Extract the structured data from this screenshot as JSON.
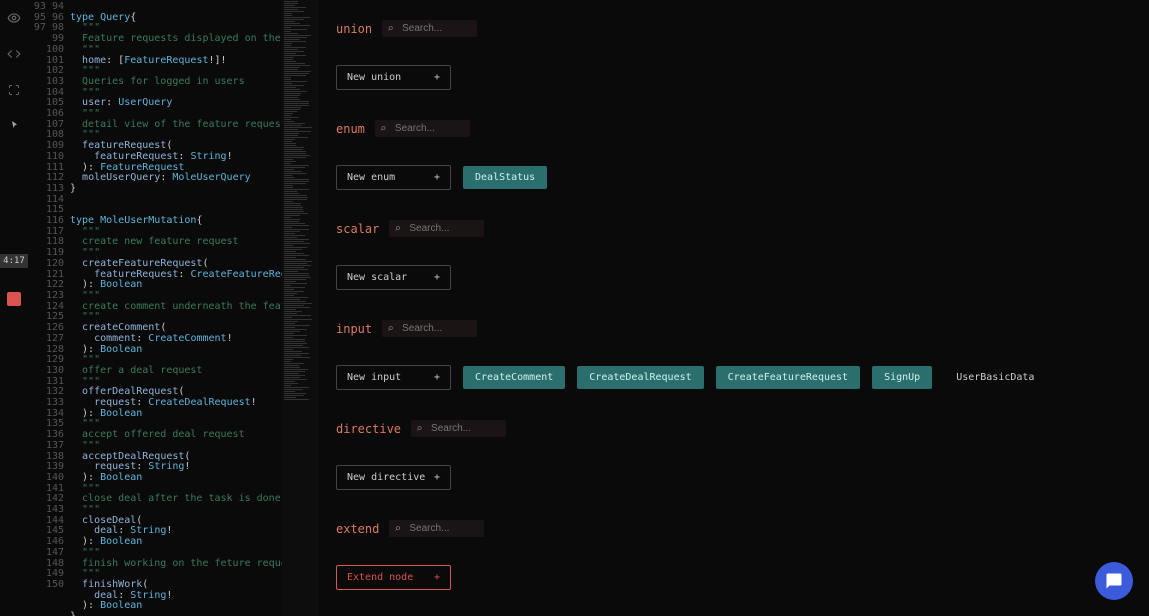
{
  "badge": "4:17",
  "code": {
    "start": 93,
    "lines": [
      {
        "t": ""
      },
      {
        "t": "type Query{",
        "cls": [
          "kw",
          "type",
          "punct"
        ]
      },
      {
        "t": "  \"\"\"",
        "c": true
      },
      {
        "t": "  Feature requests displayed on the home pag",
        "c": true
      },
      {
        "t": "  \"\"\"",
        "c": true
      },
      {
        "t": "  home: [FeatureRequest!]!"
      },
      {
        "t": "  \"\"\"",
        "c": true
      },
      {
        "t": "  Queries for logged in users",
        "c": true
      },
      {
        "t": "  \"\"\"",
        "c": true
      },
      {
        "t": "  user: UserQuery"
      },
      {
        "t": "  \"\"\"",
        "c": true
      },
      {
        "t": "  detail view of the feature request. Should",
        "c": true
      },
      {
        "t": "  \"\"\"",
        "c": true
      },
      {
        "t": "  featureRequest("
      },
      {
        "t": "    featureRequest: String!"
      },
      {
        "t": "  ): FeatureRequest"
      },
      {
        "t": "  moleUserQuery: MoleUserQuery"
      },
      {
        "t": "}"
      },
      {
        "t": ""
      },
      {
        "t": ""
      },
      {
        "t": "type MoleUserMutation{",
        "cls": [
          "kw",
          "type",
          "punct"
        ]
      },
      {
        "t": "  \"\"\"",
        "c": true
      },
      {
        "t": "  create new feature request",
        "c": true
      },
      {
        "t": "  \"\"\"",
        "c": true
      },
      {
        "t": "  createFeatureRequest("
      },
      {
        "t": "    featureRequest: CreateFeatureRequest!"
      },
      {
        "t": "  ): Boolean"
      },
      {
        "t": "  \"\"\"",
        "c": true
      },
      {
        "t": "  create comment underneath the feature requ",
        "c": true
      },
      {
        "t": "  \"\"\"",
        "c": true
      },
      {
        "t": "  createComment("
      },
      {
        "t": "    comment: CreateComment!"
      },
      {
        "t": "  ): Boolean"
      },
      {
        "t": "  \"\"\"",
        "c": true
      },
      {
        "t": "  offer a deal request",
        "c": true
      },
      {
        "t": "  \"\"\"",
        "c": true
      },
      {
        "t": "  offerDealRequest("
      },
      {
        "t": "    request: CreateDealRequest!"
      },
      {
        "t": "  ): Boolean"
      },
      {
        "t": "  \"\"\"",
        "c": true
      },
      {
        "t": "  accept offered deal request",
        "c": true
      },
      {
        "t": "  \"\"\"",
        "c": true
      },
      {
        "t": "  acceptDealRequest("
      },
      {
        "t": "    request: String!"
      },
      {
        "t": "  ): Boolean"
      },
      {
        "t": "  \"\"\"",
        "c": true
      },
      {
        "t": "  close deal after the task is done by the s",
        "c": true
      },
      {
        "t": "  \"\"\"",
        "c": true
      },
      {
        "t": "  closeDeal("
      },
      {
        "t": "    deal: String!"
      },
      {
        "t": "  ): Boolean"
      },
      {
        "t": "  \"\"\"",
        "c": true
      },
      {
        "t": "  finish working on the feture request",
        "c": true
      },
      {
        "t": "  \"\"\"",
        "c": true
      },
      {
        "t": "  finishWork("
      },
      {
        "t": "    deal: String!"
      },
      {
        "t": "  ): Boolean"
      },
      {
        "t": "}"
      }
    ]
  },
  "search_placeholder": "Search...",
  "sections": [
    {
      "key": "union",
      "title": "union",
      "new_label": "New union",
      "items": []
    },
    {
      "key": "enum",
      "title": "enum",
      "new_label": "New enum",
      "items": [
        {
          "label": "DealStatus",
          "style": "chip"
        }
      ]
    },
    {
      "key": "scalar",
      "title": "scalar",
      "new_label": "New scalar",
      "items": []
    },
    {
      "key": "input",
      "title": "input",
      "new_label": "New input",
      "items": [
        {
          "label": "CreateComment",
          "style": "chip"
        },
        {
          "label": "CreateDealRequest",
          "style": "chip"
        },
        {
          "label": "CreateFeatureRequest",
          "style": "chip"
        },
        {
          "label": "SignUp",
          "style": "chip"
        },
        {
          "label": "UserBasicData",
          "style": "plain"
        }
      ]
    },
    {
      "key": "directive",
      "title": "directive",
      "new_label": "New directive",
      "items": []
    },
    {
      "key": "extend",
      "title": "extend",
      "new_label": "Extend node",
      "items": [],
      "accent": true
    }
  ]
}
